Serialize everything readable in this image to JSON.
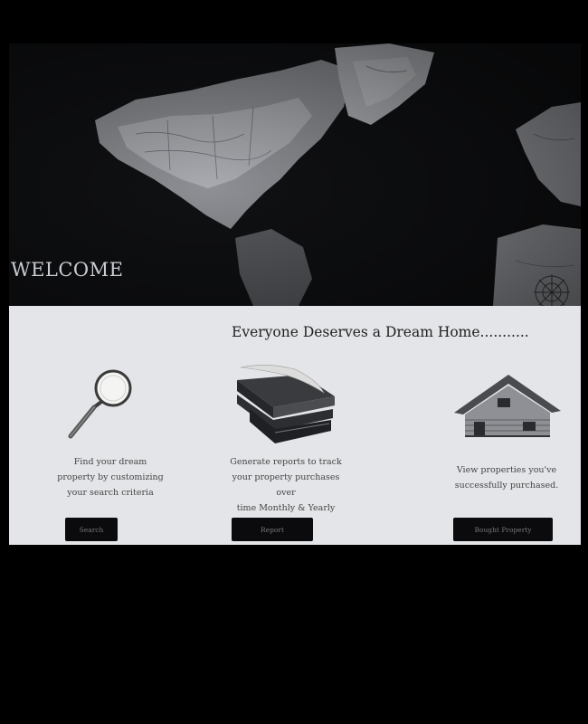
{
  "hero": {
    "welcome": "WELCOME"
  },
  "main": {
    "tagline": "Everyone Deserves a Dream Home..........."
  },
  "features": [
    {
      "icon": "magnifying-glass-icon",
      "description_lines": [
        "Find your dream",
        "property by customizing",
        "your search criteria"
      ],
      "button_label": "Search"
    },
    {
      "icon": "books-quill-icon",
      "description_lines": [
        "Generate reports to track",
        "your property purchases over",
        "time Monthly & Yearly"
      ],
      "button_label": "Report"
    },
    {
      "icon": "house-icon",
      "description_lines": [
        "View properties you've",
        "successfully purchased."
      ],
      "button_label": "Bought Property"
    }
  ]
}
